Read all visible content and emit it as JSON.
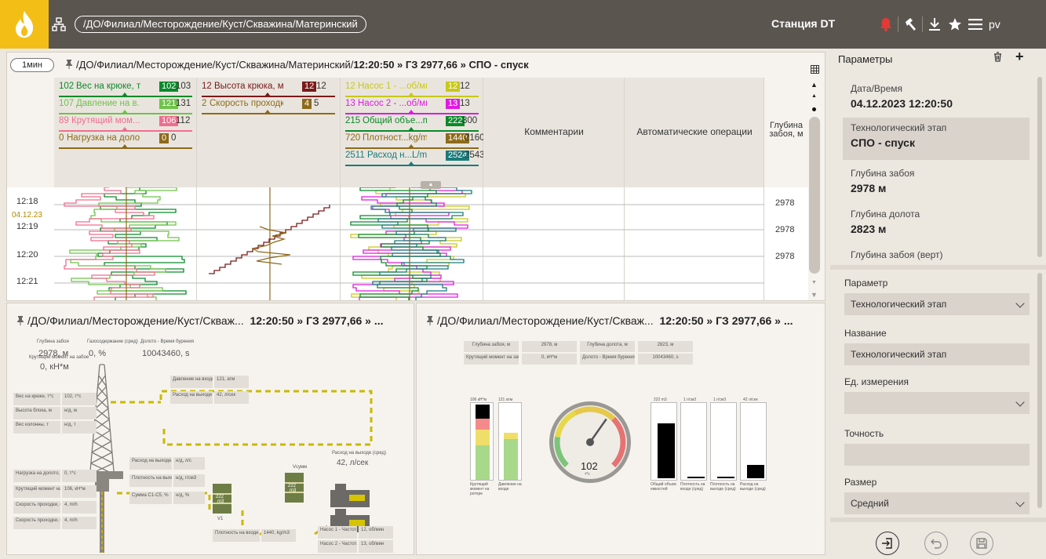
{
  "topbar": {
    "path": "/ДО/Филиал/Месторождение/Куст/Скважина/Материнский",
    "station": "Станция DT",
    "user": "pv",
    "icons": [
      "flame-logo",
      "hierarchy-icon",
      "bell-icon",
      "hammer-icon",
      "download-icon",
      "star-icon",
      "menu-icon"
    ],
    "bell_color": "#e53935",
    "logo_color": "#f3bf17"
  },
  "main_panel": {
    "interval": "1мин",
    "path": "/ДО/Филиал/Месторождение/Куст/Скважина/Материнский/",
    "status": "12:20:50 » ГЗ 2977,66 » СПО - спуск",
    "tracks": [
      {
        "params": [
          {
            "min": "102",
            "name": "Вес на крюке, т*с",
            "value": "102",
            "max": "103",
            "color": "#0a8a2a"
          },
          {
            "min": "107",
            "name": "Давление на в...атм",
            "value": "121",
            "max": "131",
            "color": "#6fc24a"
          },
          {
            "min": "89",
            "name": "Крутящий мом...кН*м",
            "value": "106",
            "max": "112",
            "color": "#ef6e8e"
          },
          {
            "min": "0",
            "name": "Нагрузка на доло...т*с",
            "value": "0",
            "max": "0",
            "color": "#8e6a1a"
          }
        ]
      },
      {
        "params": [
          {
            "min": "12",
            "name": "Высота крюка, м",
            "value": "12",
            "max": "12",
            "color": "#7a1a1a"
          },
          {
            "min": "2",
            "name": "Скорость проходки, m/h",
            "value": "4",
            "max": "5",
            "color": "#8e6a1a"
          }
        ]
      },
      {
        "params": [
          {
            "min": "12",
            "name": "Насос 1 - ...об/мин",
            "value": "12",
            "max": "12",
            "color": "#c8c81a"
          },
          {
            "min": "13",
            "name": "Насос 2 - ...об/мин",
            "value": "13",
            "max": "13",
            "color": "#e01ae0"
          },
          {
            "min": "215",
            "name": "Общий объе...m3",
            "value": "222",
            "max": "300",
            "color": "#0a8a2a"
          },
          {
            "min": "720",
            "name": "Плотност...kg/m3",
            "value": "1440",
            "max": "2160",
            "color": "#8e6a1a"
          },
          {
            "min": "2511",
            "name": "Расход н...L/min",
            "value": "2524",
            "max": "2543",
            "color": "#1a7a7a"
          }
        ]
      }
    ],
    "comments_title": "Комментарии",
    "auto_ops_title": "Автоматические операции",
    "depth_title": "Глубина забоя, м",
    "times": [
      "12:18",
      "12:19",
      "12:20",
      "12:21"
    ],
    "date": "04.12.23",
    "depth_values": [
      "2978",
      "2978",
      "2978"
    ]
  },
  "bottom_left": {
    "path": "/ДО/Филиал/Месторождение/Куст/Скваж...",
    "status": "12:20:50 » ГЗ 2977,66 » ...",
    "top_labels": [
      {
        "label": "Глубина забоя",
        "value": "2978, м"
      },
      {
        "label": "Газосодержание (сред)",
        "value": "0, %"
      },
      {
        "label": "Долото - Время бурения",
        "value": "10043460, s"
      }
    ],
    "torque": {
      "label": "Крутящий момент на забое",
      "value": "0, кН*м"
    },
    "left_rows": [
      [
        "Вес на крюке, т*с",
        "102, т*с"
      ],
      [
        "Высота блока, м",
        "н/д, м"
      ],
      [
        "Вес колонны, т",
        "н/д, т"
      ]
    ],
    "left_rows2": [
      [
        "Нагрузка на долото, т*с",
        "0, т*с"
      ],
      [
        "Крутящий момент на роторе, кН*м",
        "106, кН*м"
      ],
      [
        "Скорость проходки, m/h",
        "4, m/h"
      ],
      [
        "Скорость проходки, m/h",
        "4, m/h"
      ]
    ],
    "pressure_rows": [
      [
        "Давление на входе, атм",
        "121, атм"
      ],
      [
        "Расход на выходе (сред), л/сек",
        "42, л/сек"
      ]
    ],
    "mid_rows": [
      [
        "Расход на выходе, л/с",
        "н/д, л/с"
      ],
      [
        "Плотность на выходе, г/см3",
        "н/д, г/см3"
      ],
      [
        "Сумма С1-С5, %",
        "н/д, %"
      ]
    ],
    "tank1": {
      "value": "222",
      "unit": "m3",
      "name": "V1"
    },
    "tank2": {
      "value": "222",
      "unit": "m3",
      "name": "Vсумм"
    },
    "outflow": {
      "label": "Расход на выходе (сред)",
      "value": "42, л/сек"
    },
    "bottom_rows": [
      [
        "Плотность на входе (сред), kg/m3",
        "1440, kg/m3"
      ],
      [
        "Насос 1 - Частота ходов, об/мин",
        "12, об/мин"
      ],
      [
        "Насос 2 - Частота ходов, об/мин",
        "13, об/мин"
      ]
    ]
  },
  "bottom_right": {
    "path": "/ДО/Филиал/Месторождение/Куст/Скваж...",
    "status": "12:20:50 » ГЗ 2977,66 » ...",
    "table": [
      [
        "Глубина забоя, м",
        "2978, м",
        "Глубина долота, м",
        "2823, м"
      ],
      [
        "Крутящий момент на забое, кН*м",
        "0, кН*м",
        "Долото - Время бурения, s",
        "10043460, s"
      ]
    ],
    "gauge_value": "102",
    "gauge_unit": "т*с",
    "gauge_level": 0.63,
    "vbar1": {
      "label": "Крутящий момент на роторе",
      "top": "106 кН*м"
    },
    "vbar2": {
      "label": "Давление на входе",
      "top": "121 атм"
    },
    "bars": [
      {
        "label": "Общий объем емкостей",
        "top": "222 m3",
        "value": 0.73
      },
      {
        "label": "Плотность на входе (сред)",
        "top": "1 г/см3",
        "value": 0.02
      },
      {
        "label": "Плотность на выходе (сред)",
        "top": "1 г/см3",
        "value": 0.02
      },
      {
        "label": "Расход на выходе (сред)",
        "top": "42 л/сек",
        "value": 0.18
      }
    ]
  },
  "sidebar": {
    "title": "Параметры",
    "params": [
      {
        "label": "Дата/Время",
        "value": "04.12.2023 12:20:50"
      },
      {
        "label": "Технологический этап",
        "value": "СПО - спуск"
      },
      {
        "label": "Глубина забоя",
        "value": "2978 м"
      },
      {
        "label": "Глубина долота",
        "value": "2823 м"
      },
      {
        "label": "Глубина забоя (верт)",
        "value": ""
      }
    ],
    "form": {
      "param_label": "Параметр",
      "param_value": "Технологический этап",
      "name_label": "Название",
      "name_value": "Технологический этап",
      "unit_label": "Ед. измерения",
      "unit_value": "",
      "precision_label": "Точность",
      "precision_value": "",
      "size_label": "Размер",
      "size_value": "Средний"
    }
  }
}
